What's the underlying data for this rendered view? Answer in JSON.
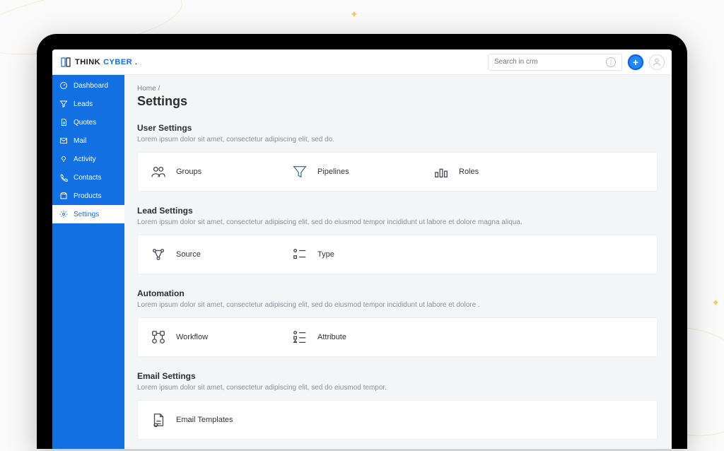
{
  "brand": {
    "part1": "THINK",
    "part2": "CYBER",
    "dot": "."
  },
  "search": {
    "placeholder": "Search in crm"
  },
  "sidebar": {
    "items": [
      {
        "label": "Dashboard"
      },
      {
        "label": "Leads"
      },
      {
        "label": "Quotes"
      },
      {
        "label": "Mail"
      },
      {
        "label": "Activity"
      },
      {
        "label": "Contacts"
      },
      {
        "label": "Products"
      },
      {
        "label": "Settings"
      }
    ]
  },
  "breadcrumb": "Home /",
  "page_title": "Settings",
  "sections": [
    {
      "title": "User Settings",
      "desc": "Lorem ipsum dolor sit amet, consectetur adipiscing elit, sed do.",
      "cards": [
        {
          "label": "Groups"
        },
        {
          "label": "Pipelines"
        },
        {
          "label": "Roles"
        }
      ]
    },
    {
      "title": "Lead Settings",
      "desc": "Lorem ipsum dolor sit amet, consectetur adipiscing elit, sed do eiusmod tempor incididunt ut labore et dolore magna aliqua.",
      "cards": [
        {
          "label": "Source"
        },
        {
          "label": "Type"
        }
      ]
    },
    {
      "title": "Automation",
      "desc": "Lorem ipsum dolor sit amet, consectetur adipiscing elit, sed do eiusmod tempor incididunt ut labore et dolore .",
      "cards": [
        {
          "label": "Workflow"
        },
        {
          "label": "Attribute"
        }
      ]
    },
    {
      "title": "Email Settings",
      "desc": "Lorem ipsum dolor sit amet, consectetur adipiscing elit, sed do eiusmod tempor.",
      "cards": [
        {
          "label": "Email Templates"
        }
      ]
    }
  ]
}
